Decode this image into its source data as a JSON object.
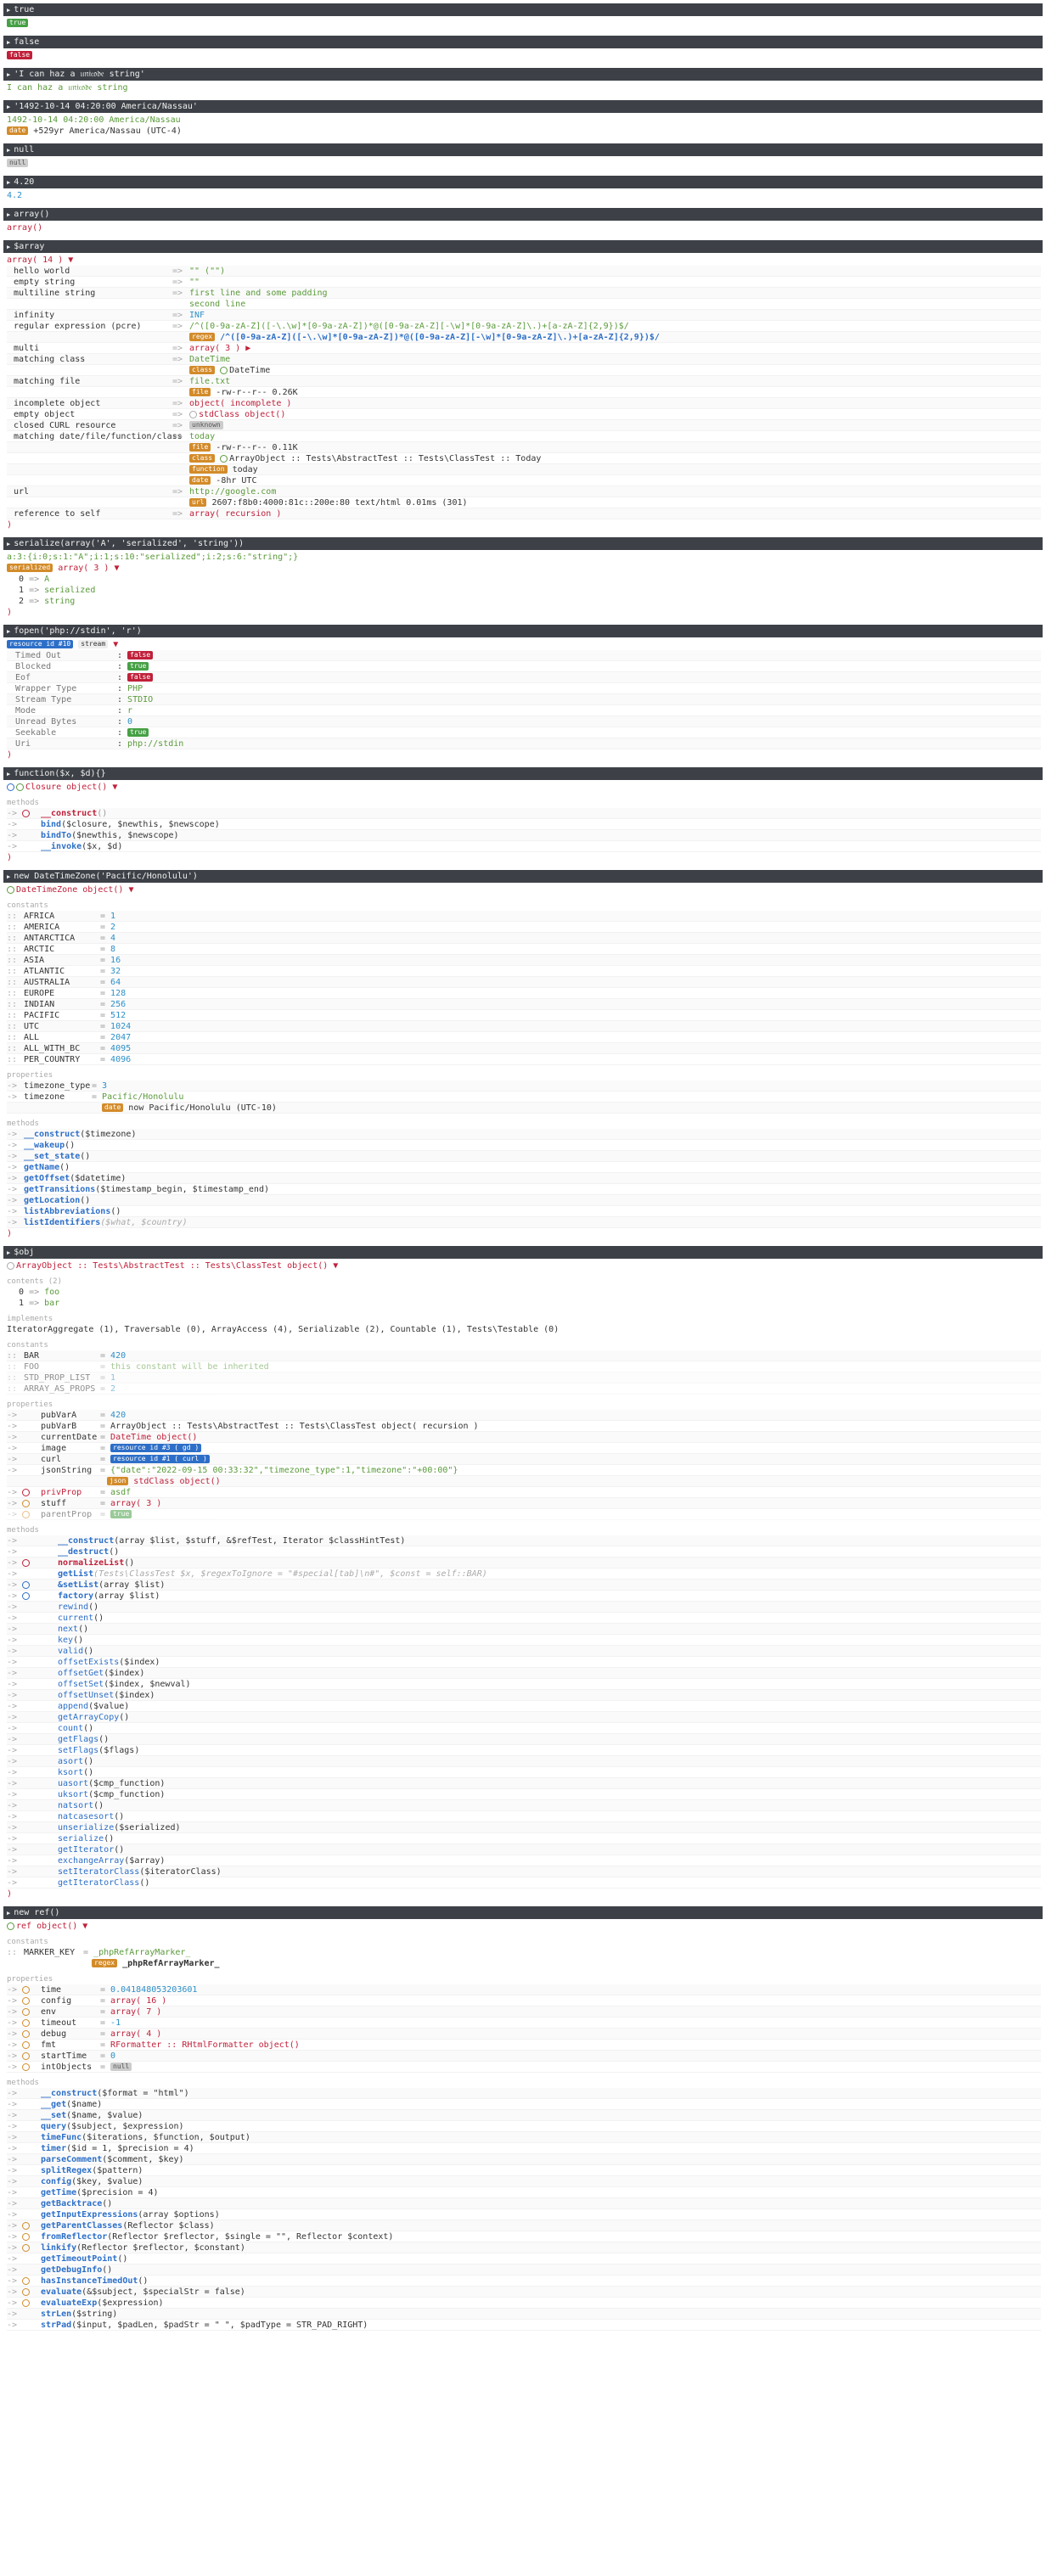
{
  "sections": {
    "true": {
      "header": "true",
      "value": "true"
    },
    "false": {
      "header": "false",
      "value": "false"
    },
    "string": {
      "header": "'I can haz a 𝔲𝔫𝔦𝔠𝔬𝔡𝔢 string'",
      "value": "I can haz a 𝔲𝔫𝔦𝔠𝔬𝔡𝔢 string"
    },
    "date": {
      "header": "'1492-10-14 04:20:00 America/Nassau'",
      "value": "1492-10-14 04:20:00 America/Nassau",
      "tag": "date",
      "rel": "+529yr America/Nassau (UTC-4)"
    },
    "null": {
      "header": "null",
      "value": "null"
    },
    "float": {
      "header": "4.20",
      "value": "4.2"
    },
    "emptyarr": {
      "header": "array()",
      "value": "array()"
    },
    "array": {
      "header": "$array",
      "summary": "array( 14 )",
      "rows": [
        {
          "k": "hello world",
          "v": "\"\" (\"\")"
        },
        {
          "k": "empty string",
          "v": "\"\""
        },
        {
          "k": "multiline string",
          "v": "first line and some padding",
          "v2": "second line"
        },
        {
          "k": "infinity",
          "v": "INF"
        },
        {
          "k": "regular expression (pcre)",
          "v": "/^([0-9a-zA-Z]([-\\.\\w]*[0-9a-zA-Z])*@([0-9a-zA-Z][-\\w]*[0-9a-zA-Z]\\.)+[a-zA-Z]{2,9})$/",
          "tag": "regex"
        },
        {
          "k": "multi",
          "v": "array( 3 )"
        },
        {
          "k": "matching class",
          "v": "DateTime",
          "tag": "class",
          "v2": "DateTime"
        },
        {
          "k": "matching file",
          "v": "file.txt",
          "tag": "file",
          "v2": "-rw-r--r-- 0.26K"
        },
        {
          "k": "incomplete object",
          "v": "object( incomplete )"
        },
        {
          "k": "empty object",
          "v": "stdClass object()"
        },
        {
          "k": "closed CURL resource",
          "v": "unknown"
        },
        {
          "k": "matching date/file/function/class",
          "v": "today",
          "v2": "-rw-r--r-- 0.11K",
          "v3": "today",
          "v4": "-8hr UTC"
        },
        {
          "k": "url",
          "v": "http://google.com",
          "v2": "2607:f8b0:4000:81c::200e:80 text/html 0.01ms (301)"
        },
        {
          "k": "reference to self",
          "v": "array( recursion )"
        }
      ],
      "callable": "ArrayObject :: Tests\\AbstractTest :: Tests\\ClassTest :: Today"
    },
    "serialize": {
      "header": "serialize(array('A', 'serialized', 'string'))",
      "value": "a:3:{i:0;s:1:\"A\";i:1;s:10:\"serialized\";i:2;s:6:\"string\";}",
      "tag": "serialized",
      "summary": "array( 3 )",
      "items": [
        {
          "k": "0",
          "v": "A"
        },
        {
          "k": "1",
          "v": "serialized"
        },
        {
          "k": "2",
          "v": "string"
        }
      ]
    },
    "fopen": {
      "header": "fopen('php://stdin', 'r')",
      "summary": "resource id #10",
      "kind": "stream",
      "rows": [
        {
          "k": "Timed Out",
          "v": "false"
        },
        {
          "k": "Blocked",
          "v": "true"
        },
        {
          "k": "Eof",
          "v": "false"
        },
        {
          "k": "Wrapper Type",
          "v": "PHP"
        },
        {
          "k": "Stream Type",
          "v": "STDIO"
        },
        {
          "k": "Mode",
          "v": "r"
        },
        {
          "k": "Unread Bytes",
          "v": "0"
        },
        {
          "k": "Seekable",
          "v": "true"
        },
        {
          "k": "Uri",
          "v": "php://stdin"
        }
      ]
    },
    "closure": {
      "header": "function($x, $d){}",
      "summary": "Closure object()",
      "methods_label": "methods",
      "methods": [
        {
          "n": "__construct",
          "a": "()"
        },
        {
          "n": "bind",
          "a": "($closure, $newthis, $newscope)"
        },
        {
          "n": "bindTo",
          "a": "($newthis, $newscope)"
        },
        {
          "n": "__invoke",
          "a": "($x, $d)"
        }
      ]
    },
    "tz": {
      "header": "new DateTimeZone('Pacific/Honolulu')",
      "summary": "DateTimeZone object()",
      "const_label": "constants",
      "consts": [
        {
          "k": "AFRICA",
          "v": "1"
        },
        {
          "k": "AMERICA",
          "v": "2"
        },
        {
          "k": "ANTARCTICA",
          "v": "4"
        },
        {
          "k": "ARCTIC",
          "v": "8"
        },
        {
          "k": "ASIA",
          "v": "16"
        },
        {
          "k": "ATLANTIC",
          "v": "32"
        },
        {
          "k": "AUSTRALIA",
          "v": "64"
        },
        {
          "k": "EUROPE",
          "v": "128"
        },
        {
          "k": "INDIAN",
          "v": "256"
        },
        {
          "k": "PACIFIC",
          "v": "512"
        },
        {
          "k": "UTC",
          "v": "1024"
        },
        {
          "k": "ALL",
          "v": "2047"
        },
        {
          "k": "ALL_WITH_BC",
          "v": "4095"
        },
        {
          "k": "PER_COUNTRY",
          "v": "4096"
        }
      ],
      "props_label": "properties",
      "props": [
        {
          "k": "timezone_type",
          "v": "3"
        },
        {
          "k": "timezone",
          "v": "Pacific/Honolulu",
          "v2": "now Pacific/Honolulu (UTC-10)"
        }
      ],
      "methods_label": "methods",
      "methods": [
        {
          "n": "__construct",
          "a": "($timezone)"
        },
        {
          "n": "__wakeup",
          "a": "()"
        },
        {
          "n": "__set_state",
          "a": "()"
        },
        {
          "n": "getName",
          "a": "()"
        },
        {
          "n": "getOffset",
          "a": "($datetime)"
        },
        {
          "n": "getTransitions",
          "a": "($timestamp_begin, $timestamp_end)"
        },
        {
          "n": "getLocation",
          "a": "()"
        },
        {
          "n": "listAbbreviations",
          "a": "()"
        },
        {
          "n": "listIdentifiers",
          "a": "($what, $country)"
        }
      ]
    },
    "obj": {
      "header": "$obj",
      "summary": "ArrayObject :: Tests\\AbstractTest :: Tests\\ClassTest object()",
      "contents_label": "contents (2)",
      "contents": [
        {
          "k": "0",
          "v": "foo"
        },
        {
          "k": "1",
          "v": "bar"
        }
      ],
      "impl_label": "implements",
      "impl": "IteratorAggregate (1), Traversable (0), ArrayAccess (4), Serializable (2), Countable (1), Tests\\Testable (0)",
      "const_label": "constants",
      "consts": [
        {
          "k": "BAR",
          "v": "420"
        },
        {
          "k": "FOO",
          "v": "this constant will be inherited"
        },
        {
          "k": "STD_PROP_LIST",
          "v": "1"
        },
        {
          "k": "ARRAY_AS_PROPS",
          "v": "2"
        }
      ],
      "props_label": "properties",
      "props": [
        {
          "k": "pubVarA",
          "v": "420"
        },
        {
          "k": "pubVarB",
          "v": "ArrayObject :: Tests\\AbstractTest :: Tests\\ClassTest object( recursion )"
        },
        {
          "k": "currentDate",
          "v": "DateTime object()"
        },
        {
          "k": "image",
          "v": "resource id #3 ( gd )"
        },
        {
          "k": "curl",
          "v": "resource id #1 ( curl )"
        },
        {
          "k": "jsonString",
          "v": "{\"date\":\"2022-09-15 00:33:32\",\"timezone_type\":1,\"timezone\":\"+00:00\"}",
          "v2": "stdClass object()"
        },
        {
          "k": "privProp",
          "v": "asdf"
        },
        {
          "k": "stuff",
          "v": "array( 3 )"
        },
        {
          "k": "parentProp",
          "v": "true"
        }
      ],
      "methods_label": "methods",
      "methods": [
        {
          "n": "__construct",
          "a": "(array $list, $stuff, &$refTest, Iterator $classHintTest)"
        },
        {
          "n": "__destruct",
          "a": "()"
        },
        {
          "n": "normalizeList",
          "a": "()"
        },
        {
          "n": "getList",
          "a": "(Tests\\ClassTest $x, $regexToIgnore = \"#special[tab]\\n#\", $const = self::BAR)"
        },
        {
          "n": "&setList",
          "a": "(array $list)"
        },
        {
          "n": "factory",
          "a": "(array $list)"
        },
        {
          "n": "rewind",
          "a": "()"
        },
        {
          "n": "current",
          "a": "()"
        },
        {
          "n": "next",
          "a": "()"
        },
        {
          "n": "key",
          "a": "()"
        },
        {
          "n": "valid",
          "a": "()"
        },
        {
          "n": "offsetExists",
          "a": "($index)"
        },
        {
          "n": "offsetGet",
          "a": "($index)"
        },
        {
          "n": "offsetSet",
          "a": "($index, $newval)"
        },
        {
          "n": "offsetUnset",
          "a": "($index)"
        },
        {
          "n": "append",
          "a": "($value)"
        },
        {
          "n": "getArrayCopy",
          "a": "()"
        },
        {
          "n": "count",
          "a": "()"
        },
        {
          "n": "getFlags",
          "a": "()"
        },
        {
          "n": "setFlags",
          "a": "($flags)"
        },
        {
          "n": "asort",
          "a": "()"
        },
        {
          "n": "ksort",
          "a": "()"
        },
        {
          "n": "uasort",
          "a": "($cmp_function)"
        },
        {
          "n": "uksort",
          "a": "($cmp_function)"
        },
        {
          "n": "natsort",
          "a": "()"
        },
        {
          "n": "natcasesort",
          "a": "()"
        },
        {
          "n": "unserialize",
          "a": "($serialized)"
        },
        {
          "n": "serialize",
          "a": "()"
        },
        {
          "n": "getIterator",
          "a": "()"
        },
        {
          "n": "exchangeArray",
          "a": "($array)"
        },
        {
          "n": "setIteratorClass",
          "a": "($iteratorClass)"
        },
        {
          "n": "getIteratorClass",
          "a": "()"
        }
      ]
    },
    "ref": {
      "header": "new ref()",
      "summary": "ref object()",
      "const_label": "constants",
      "consts": [
        {
          "k": "MARKER_KEY",
          "v": "_phpRefArrayMarker_",
          "v2": "_phpRefArrayMarker_"
        }
      ],
      "props_label": "properties",
      "props": [
        {
          "k": "time",
          "v": "0.041848053203601"
        },
        {
          "k": "config",
          "v": "array( 16 )"
        },
        {
          "k": "env",
          "v": "array( 7 )"
        },
        {
          "k": "timeout",
          "v": "-1"
        },
        {
          "k": "debug",
          "v": "array( 4 )"
        },
        {
          "k": "fmt",
          "v": "RFormatter :: RHtmlFormatter object()"
        },
        {
          "k": "startTime",
          "v": "0"
        },
        {
          "k": "intObjects",
          "v": "null"
        }
      ],
      "methods_label": "methods",
      "methods": [
        {
          "n": "__construct",
          "a": "($format = \"html\")"
        },
        {
          "n": "__get",
          "a": "($name)"
        },
        {
          "n": "__set",
          "a": "($name, $value)"
        },
        {
          "n": "query",
          "a": "($subject, $expression)"
        },
        {
          "n": "timeFunc",
          "a": "($iterations, $function, $output)"
        },
        {
          "n": "timer",
          "a": "($id = 1, $precision = 4)"
        },
        {
          "n": "parseComment",
          "a": "($comment, $key)"
        },
        {
          "n": "splitRegex",
          "a": "($pattern)"
        },
        {
          "n": "config",
          "a": "($key, $value)"
        },
        {
          "n": "getTime",
          "a": "($precision = 4)"
        },
        {
          "n": "getBacktrace",
          "a": "()"
        },
        {
          "n": "getInputExpressions",
          "a": "(array $options)"
        },
        {
          "n": "getParentClasses",
          "a": "(Reflector $class)"
        },
        {
          "n": "fromReflector",
          "a": "(Reflector $reflector, $single = \"\", Reflector $context)"
        },
        {
          "n": "linkify",
          "a": "(Reflector $reflector, $constant)"
        },
        {
          "n": "getTimeoutPoint",
          "a": "()"
        },
        {
          "n": "getDebugInfo",
          "a": "()"
        },
        {
          "n": "hasInstanceTimedOut",
          "a": "()"
        },
        {
          "n": "evaluate",
          "a": "(&$subject, $specialStr = false)"
        },
        {
          "n": "evaluateExp",
          "a": "($expression)"
        },
        {
          "n": "strLen",
          "a": "($string)"
        },
        {
          "n": "strPad",
          "a": "($input, $padLen, $padStr = \" \", $padType = STR_PAD_RIGHT)"
        }
      ]
    }
  }
}
